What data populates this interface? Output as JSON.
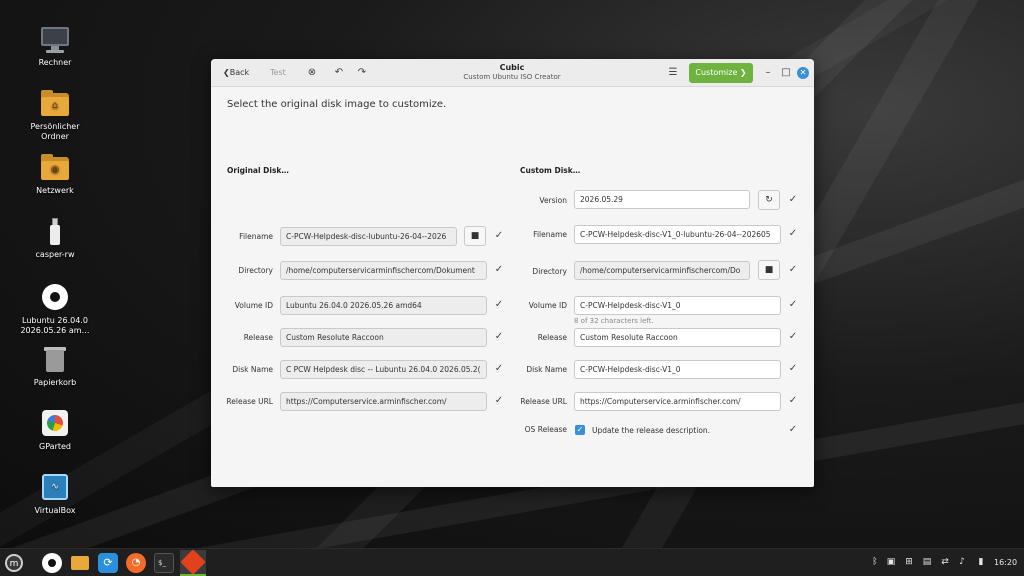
{
  "desktop": {
    "icons": [
      {
        "label": "Rechner",
        "icon": "computer-icon"
      },
      {
        "label": "Persönlicher\nOrdner",
        "icon": "home-folder-icon"
      },
      {
        "label": "Netzwerk",
        "icon": "network-folder-icon"
      },
      {
        "label": "casper-rw",
        "icon": "usb-drive-icon"
      },
      {
        "label": "Lubuntu 26.04.0\n2026.05.26 am…",
        "icon": "disc-icon"
      },
      {
        "label": "Papierkorb",
        "icon": "trash-icon"
      },
      {
        "label": "GParted",
        "icon": "gparted-icon"
      },
      {
        "label": "VirtualBox",
        "icon": "virtualbox-icon"
      }
    ]
  },
  "window": {
    "title": "Cubic",
    "subtitle": "Custom Ubuntu ISO Creator",
    "back_label": "Back",
    "test_label": "Test",
    "customize_label": "Customize",
    "instruction": "Select the original disk image to customize.",
    "original": {
      "heading": "Original Disk…",
      "rows": {
        "filename": {
          "label": "Filename",
          "value": "C-PCW-Helpdesk-disc-lubuntu-26-04--2026"
        },
        "directory": {
          "label": "Directory",
          "value": "/home/computerservicarminfischercom/Dokument"
        },
        "volume_id": {
          "label": "Volume ID",
          "value": "Lubuntu 26.04.0 2026.05.26 amd64"
        },
        "release": {
          "label": "Release",
          "value": "Custom Resolute Raccoon"
        },
        "disk_name": {
          "label": "Disk Name",
          "value": "C PCW Helpdesk disc -- Lubuntu 26.04.0 2026.05.2("
        },
        "release_url": {
          "label": "Release URL",
          "value": "https://Computerservice.arminfischer.com/"
        }
      }
    },
    "custom": {
      "heading": "Custom Disk…",
      "rows": {
        "version": {
          "label": "Version",
          "value": "2026.05.29"
        },
        "filename": {
          "label": "Filename",
          "value": "C-PCW-Helpdesk-disc-V1_0-lubuntu-26-04--202605"
        },
        "directory": {
          "label": "Directory",
          "value": "/home/computerservicarminfischercom/Do"
        },
        "volume_id": {
          "label": "Volume ID",
          "value": "C-PCW-Helpdesk-disc-V1_0",
          "hint": "8 of 32 characters left."
        },
        "release": {
          "label": "Release",
          "value": "Custom Resolute Raccoon"
        },
        "disk_name": {
          "label": "Disk Name",
          "value": "C-PCW-Helpdesk-disc-V1_0"
        },
        "release_url": {
          "label": "Release URL",
          "value": "https://Computerservice.arminfischer.com/"
        },
        "os_release": {
          "label": "OS Release",
          "checkbox_label": "Update the release description.",
          "checked": true
        }
      }
    }
  },
  "taskbar": {
    "clock": "16:20",
    "accent": "#6fb33f"
  },
  "colors": {
    "customize_button": "#6fb33f",
    "close_button": "#3a8fd9",
    "checkbox": "#3a8fd9"
  }
}
